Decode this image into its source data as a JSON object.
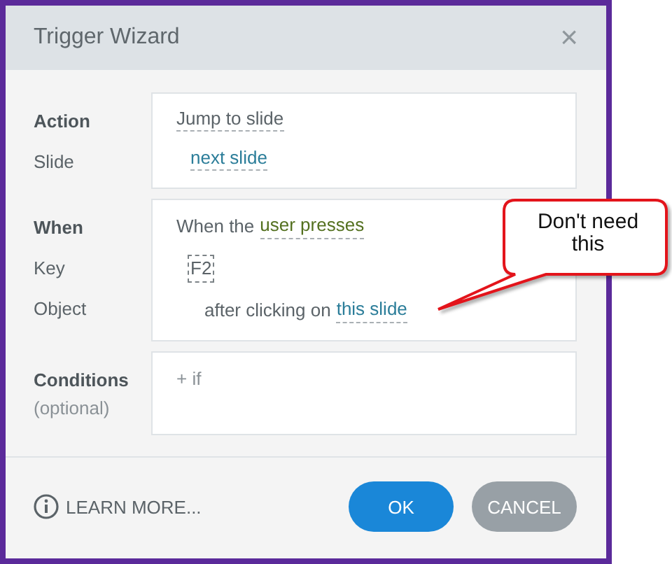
{
  "dialog": {
    "title": "Trigger Wizard",
    "close": "×"
  },
  "action": {
    "label": "Action",
    "action_link": "Jump to slide",
    "slide_label": "Slide",
    "slide_link": "next slide"
  },
  "when": {
    "label": "When",
    "prefix": "When the",
    "event_link": "user presses",
    "key_label": "Key",
    "key": "F2",
    "object_label": "Object",
    "object_prefix": "after clicking on",
    "object_link": "this slide"
  },
  "conditions": {
    "label": "Conditions",
    "note": "(optional)",
    "add": "+ if"
  },
  "footer": {
    "learn_more": "LEARN MORE...",
    "buttons": [
      {
        "label": "OK",
        "kind": "primary"
      },
      {
        "label": "CANCEL",
        "kind": "secondary"
      }
    ]
  },
  "annotation": {
    "text": "Don't need this"
  }
}
